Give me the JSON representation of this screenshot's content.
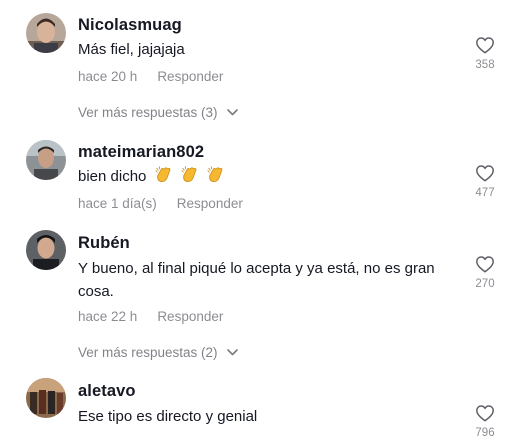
{
  "comments": [
    {
      "username": "Nicolasmuag",
      "text": "Más fiel, jajajaja",
      "time": "hace 20 h",
      "reply_label": "Responder",
      "likes": "358",
      "more_replies": "Ver más respuestas (3)"
    },
    {
      "username": "mateimarian802",
      "text": "bien dicho",
      "emoji": "clapping-hands",
      "emoji_count": 3,
      "time": "hace 1 día(s)",
      "reply_label": "Responder",
      "likes": "477"
    },
    {
      "username": "Rubén",
      "text": "Y bueno, al final piqué lo acepta y ya está, no es gran cosa.",
      "time": "hace 22 h",
      "reply_label": "Responder",
      "likes": "270",
      "more_replies": "Ver más respuestas (2)"
    },
    {
      "username": "aletavo",
      "text": "Ese tipo es directo y genial",
      "likes": "796"
    }
  ],
  "icons": {
    "like": "heart-outline-icon",
    "expand": "chevron-down-icon"
  },
  "colors": {
    "text_primary": "#161823",
    "text_secondary": "#8a8b91",
    "emoji_yellow": "#f5b82e"
  }
}
